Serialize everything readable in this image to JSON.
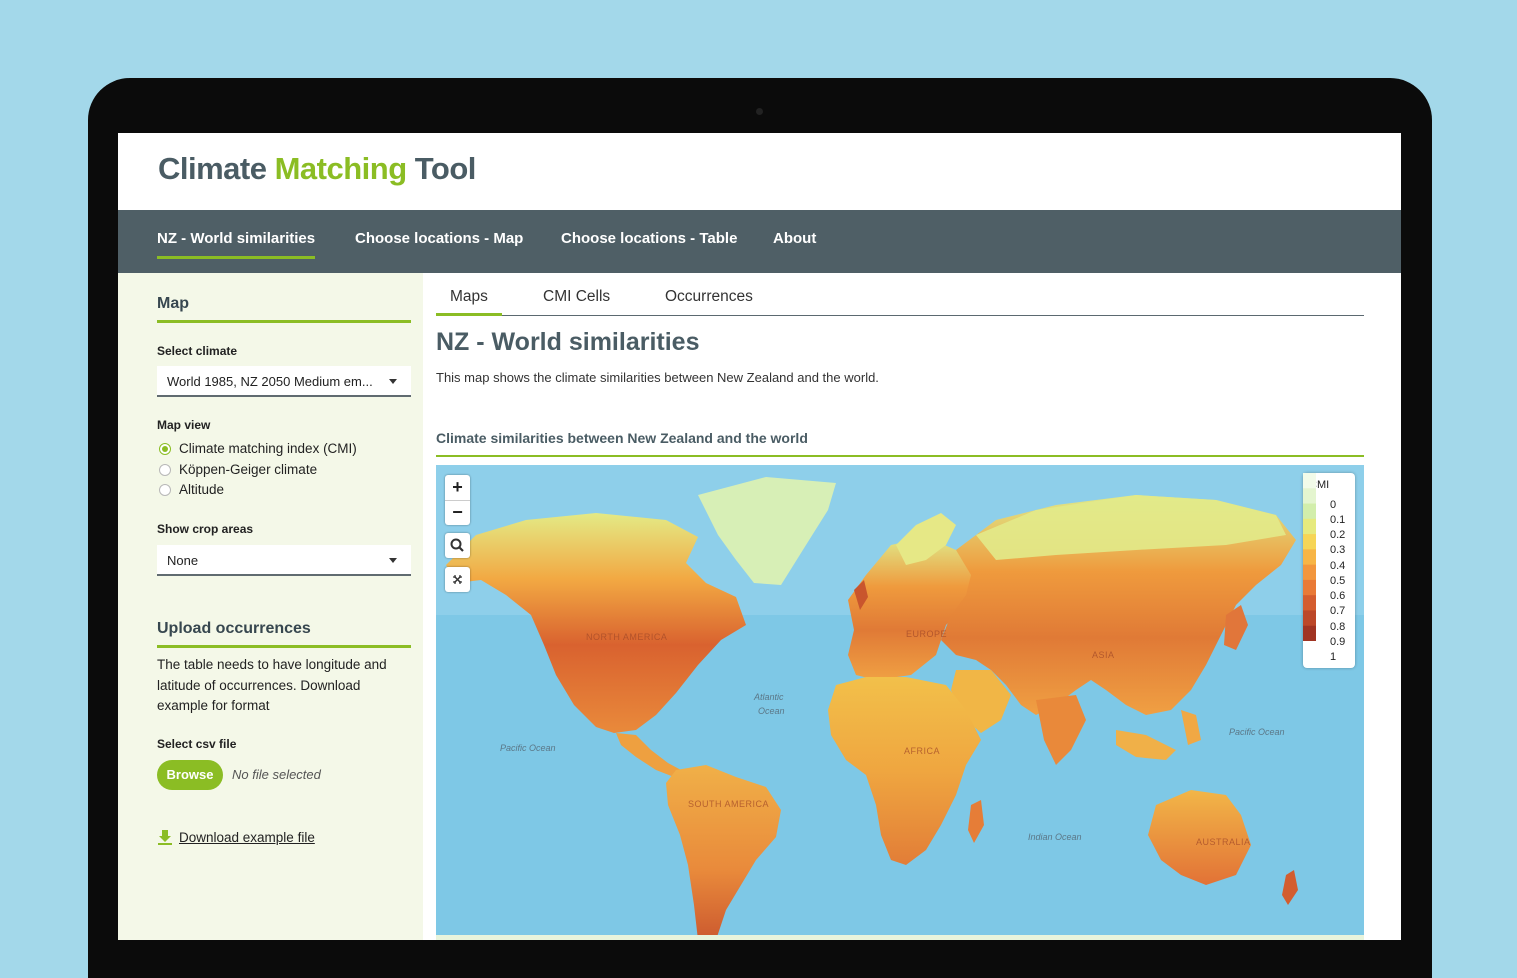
{
  "app": {
    "title_part1": "Climate",
    "title_part2": "Matching",
    "title_part3": "Tool"
  },
  "nav": {
    "items": [
      {
        "label": "NZ - World similarities",
        "active": true
      },
      {
        "label": "Choose locations - Map",
        "active": false
      },
      {
        "label": "Choose locations - Table",
        "active": false
      },
      {
        "label": "About",
        "active": false
      }
    ]
  },
  "sidebar": {
    "map_heading": "Map",
    "select_climate_label": "Select climate",
    "select_climate_value": "World 1985, NZ 2050 Medium em...",
    "map_view_label": "Map view",
    "map_view_options": [
      {
        "label": "Climate matching index (CMI)",
        "selected": true
      },
      {
        "label": "Köppen-Geiger climate",
        "selected": false
      },
      {
        "label": "Altitude",
        "selected": false
      }
    ],
    "crop_label": "Show crop areas",
    "crop_value": "None",
    "upload_heading": "Upload occurrences",
    "upload_text": "The table needs to have longitude and latitude of occurrences. Download example for format",
    "csv_label": "Select csv file",
    "browse_label": "Browse",
    "no_file_text": "No file selected",
    "download_label": "Download example file"
  },
  "main": {
    "tabs": [
      {
        "label": "Maps",
        "active": true
      },
      {
        "label": "CMI Cells",
        "active": false
      },
      {
        "label": "Occurrences",
        "active": false
      }
    ],
    "title": "NZ - World similarities",
    "description": "This map shows the climate similarities between New Zealand and the world.",
    "section_title": "Climate similarities between New Zealand and the world"
  },
  "map": {
    "zoom_in": "+",
    "zoom_out": "−",
    "legend_title": "CMI",
    "legend_values": [
      "0",
      "0.1",
      "0.2",
      "0.3",
      "0.4",
      "0.5",
      "0.6",
      "0.7",
      "0.8",
      "0.9",
      "1"
    ],
    "legend_colors": [
      "#f2fbe9",
      "#e4f5cf",
      "#d2eeab",
      "#e6ea7e",
      "#f6d556",
      "#f7b546",
      "#f2963d",
      "#e97a37",
      "#d45d2f",
      "#bc4728",
      "#a03322"
    ],
    "labels": {
      "north_america": "NORTH AMERICA",
      "europe": "EUROPE",
      "asia": "ASIA",
      "africa": "AFRICA",
      "south_america": "SOUTH AMERICA",
      "australia": "AUSTRALIA",
      "atlantic_1": "Atlantic",
      "atlantic_2": "Ocean",
      "pacific_left": "Pacific Ocean",
      "pacific_right": "Pacific Ocean",
      "indian": "Indian Ocean"
    },
    "colors": {
      "ocean": "#7ec8e6",
      "ice": "#d7efb6",
      "accent": "#8bbd24"
    }
  }
}
